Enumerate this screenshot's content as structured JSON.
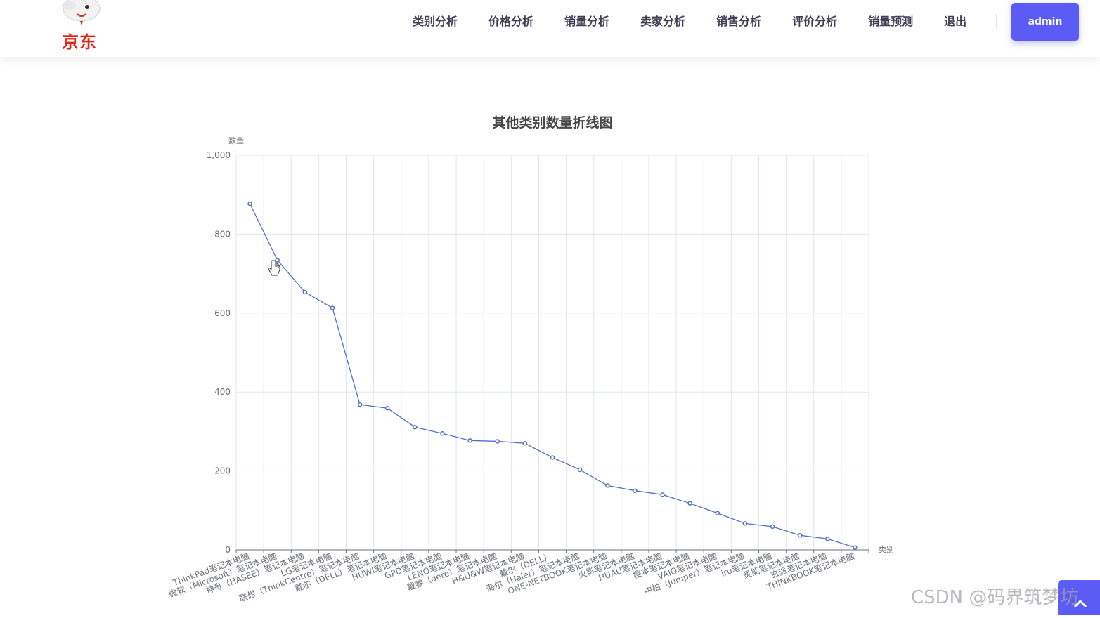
{
  "header": {
    "logo_text": "京东",
    "nav": [
      "类别分析",
      "价格分析",
      "销量分析",
      "卖家分析",
      "销售分析",
      "评价分析",
      "销量预测",
      "退出"
    ],
    "admin_label": "admin"
  },
  "colors": {
    "accent": "#5b5bf5",
    "brand": "#e1251b",
    "series_line": "#5470c6"
  },
  "watermark": "CSDN @码界筑梦坊",
  "chart_data": {
    "type": "line",
    "title": "其他类别数量折线图",
    "xlabel": "类别",
    "ylabel": "数量",
    "ylim": [
      0,
      1000
    ],
    "yticks": [
      0,
      200,
      400,
      600,
      800,
      1000
    ],
    "ytick_labels": [
      "0",
      "200",
      "400",
      "600",
      "800",
      "1,000"
    ],
    "grid": true,
    "categories": [
      "ThinkPad笔记本电脑",
      "微软（Microsoft）笔记本电脑",
      "神舟（HASEE）笔记本电脑",
      "LG笔记本电脑",
      "联想（ThinkCentre）笔记本电脑",
      "戴尔（DELL）笔记本电脑",
      "HUWI笔记本电脑",
      "GPD笔记本电脑",
      "LENO笔记本电脑",
      "戴睿（dere）笔记本电脑",
      "H&U&W笔记本电脑",
      "戴尔（DELL）",
      "海尔（Haier）笔记本电脑",
      "ONE-NETBOOK笔记本电脑",
      "火影笔记本电脑",
      "HUAU笔记本电脑",
      "樱本笔记本电脑",
      "VAIO笔记本电脑",
      "中柏（Jumper）笔记本电脑",
      "iru笔记本电脑",
      "炙能笔记本电脑",
      "玄派笔记本电脑",
      "THINKBOOK笔记本电脑"
    ],
    "series": [
      {
        "values": [
          877,
          734,
          653,
          613,
          368,
          359,
          311,
          295,
          277,
          275,
          270,
          234,
          203,
          163,
          150,
          140,
          118,
          93,
          67,
          59,
          37,
          28,
          6
        ]
      }
    ]
  }
}
